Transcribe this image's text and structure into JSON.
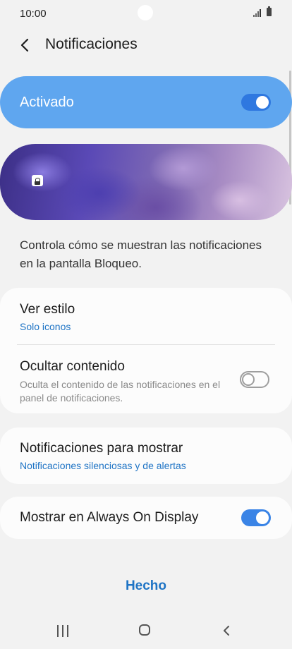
{
  "status_bar": {
    "time": "10:00"
  },
  "header": {
    "title": "Notificaciones"
  },
  "master_switch": {
    "label": "Activado",
    "on": true
  },
  "description": "Controla cómo se muestran las notificaciones en la pantalla Bloqueo.",
  "settings": {
    "view_style": {
      "title": "Ver estilo",
      "value": "Solo iconos"
    },
    "hide_content": {
      "title": "Ocultar contenido",
      "description": "Oculta el contenido de las notificaciones en el panel de notificaciones.",
      "on": false
    },
    "notifications_to_show": {
      "title": "Notificaciones para mostrar",
      "value": "Notificaciones silenciosas y de alertas"
    },
    "always_on_display": {
      "title": "Mostrar en Always On Display",
      "on": true
    }
  },
  "footer": {
    "done_label": "Hecho"
  },
  "colors": {
    "accent": "#1f74c5",
    "switch_on": "#3a84e6",
    "master_bg": "#5fa6ef"
  }
}
